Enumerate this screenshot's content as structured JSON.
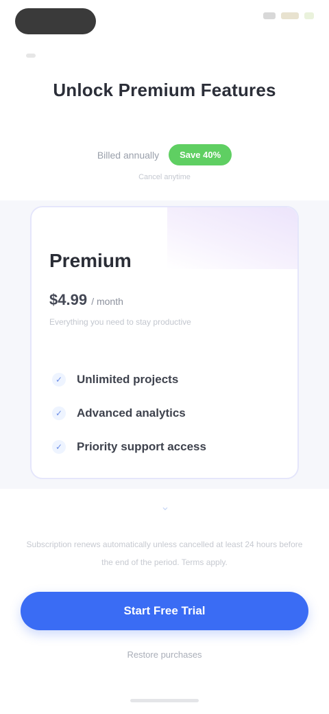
{
  "status_bar": {
    "time": "",
    "icons": [
      "signal-icon",
      "wifi-icon",
      "battery-icon"
    ]
  },
  "header": {
    "title": "Unlock Premium Features"
  },
  "billing_toggle": {
    "label": "Billed annually",
    "badge": "Save 40%",
    "subtext": "Cancel anytime"
  },
  "plan": {
    "name": "Premium",
    "price": "$4.99",
    "period": "/ month",
    "description": "Everything you need to stay productive",
    "features": [
      {
        "icon": "check-icon",
        "text": "Unlimited projects"
      },
      {
        "icon": "check-icon",
        "text": "Advanced analytics"
      },
      {
        "icon": "check-icon",
        "text": "Priority support access"
      }
    ]
  },
  "footer": {
    "fine_print": "Subscription renews automatically unless cancelled at least 24 hours before the end of the period. Terms apply.",
    "cta_label": "Start Free Trial",
    "secondary_label": "Restore purchases"
  },
  "colors": {
    "accent": "#3a6cf4",
    "badge_green": "#5fcf62",
    "card_border": "#e5e6fb"
  }
}
